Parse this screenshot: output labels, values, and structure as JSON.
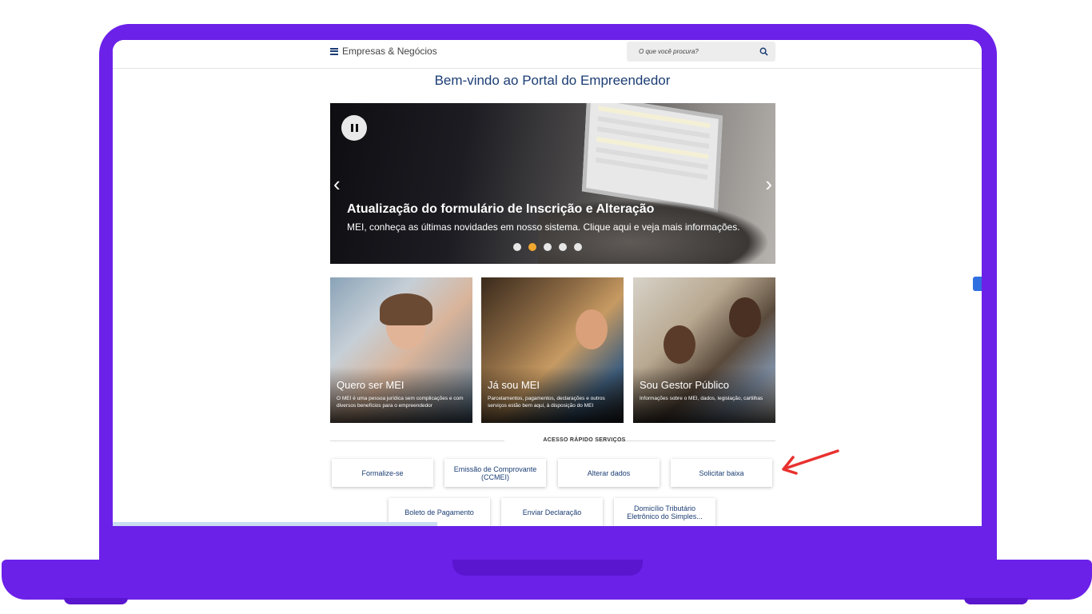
{
  "header": {
    "menu_label": "Empresas & Negócios",
    "search_placeholder": "O que você procura?"
  },
  "page_title": "Bem-vindo ao Portal do Empreendedor",
  "hero": {
    "title": "Atualização do formulário de Inscrição e Alteração",
    "subtitle": "MEI, conheça as últimas novidades em nosso sistema. Clique aqui e veja mais informações.",
    "slide_count": 5,
    "active_slide": 2
  },
  "cards": [
    {
      "title": "Quero ser MEI",
      "description": "O MEI é uma pessoa jurídica sem complicações e com diversos benefícios para o empreendedor"
    },
    {
      "title": "Já sou MEI",
      "description": "Parcelamentos, pagamentos, declarações e outros serviços estão bem aqui, à disposição do MEI"
    },
    {
      "title": "Sou Gestor Público",
      "description": "Informações sobre o MEI, dados, legislação, cartilhas"
    }
  ],
  "quick_access": {
    "label": "ACESSO RÁPIDO SERVIÇOS",
    "buttons": [
      "Formalize-se",
      "Emissão de Comprovante (CCMEI)",
      "Alterar dados",
      "Solicitar baixa",
      "Boleto de Pagamento",
      "Enviar Declaração",
      "Domicílio Tributário Eletrônico do Simples..."
    ]
  },
  "colors": {
    "frame": "#6b21e8",
    "brand_blue": "#1b3d74",
    "active_dot": "#f0a830",
    "annotation_arrow": "#e8312f"
  }
}
